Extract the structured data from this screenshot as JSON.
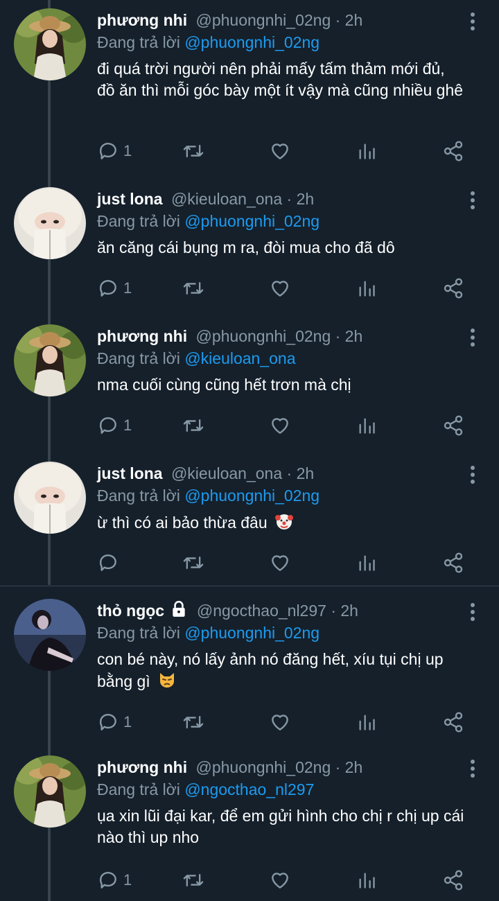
{
  "colors": {
    "background": "#15202b",
    "text": "#ffffff",
    "secondary": "#8899a6",
    "link": "#1d9bf0",
    "line": "#38444d"
  },
  "reply_prefix": "Đang trả lời",
  "tweets": [
    {
      "name": "phương nhi",
      "handle": "@phuongnhi_02ng",
      "time": "· 2h",
      "reply_to": "@phuongnhi_02ng",
      "text": "đi quá trời người nên phải mấy tấm thảm mới đủ, đồ ăn thì mỗi góc bày một ít vậy mà cũng nhiều ghê",
      "reply_count": "1"
    },
    {
      "name": "just lona",
      "handle": "@kieuloan_ona",
      "time": "· 2h",
      "reply_to": "@phuongnhi_02ng",
      "text": "ăn căng cái bụng m ra, đòi mua cho đã dô",
      "reply_count": "1"
    },
    {
      "name": "phương nhi",
      "handle": "@phuongnhi_02ng",
      "time": "· 2h",
      "reply_to": "@kieuloan_ona",
      "text": "nma cuối cùng cũng hết trơn mà chị",
      "reply_count": "1"
    },
    {
      "name": "just lona",
      "handle": "@kieuloan_ona",
      "time": "· 2h",
      "reply_to": "@phuongnhi_02ng",
      "text": "ừ thì có ai bảo thừa đâu",
      "reply_count": ""
    },
    {
      "name": "thỏ ngọc",
      "handle": "@ngocthao_nl297",
      "time": "· 2h",
      "reply_to": "@phuongnhi_02ng",
      "text": "con bé này, nó lấy ảnh nó đăng hết, xíu tụi chị up bằng gì",
      "reply_count": "1"
    },
    {
      "name": "phương nhi",
      "handle": "@phuongnhi_02ng",
      "time": "· 2h",
      "reply_to": "@ngocthao_nl297",
      "text": "ụa xin lũi đại kar, để em gửi hình cho chị r chị up cái nào thì up nho",
      "reply_count": "1"
    }
  ]
}
